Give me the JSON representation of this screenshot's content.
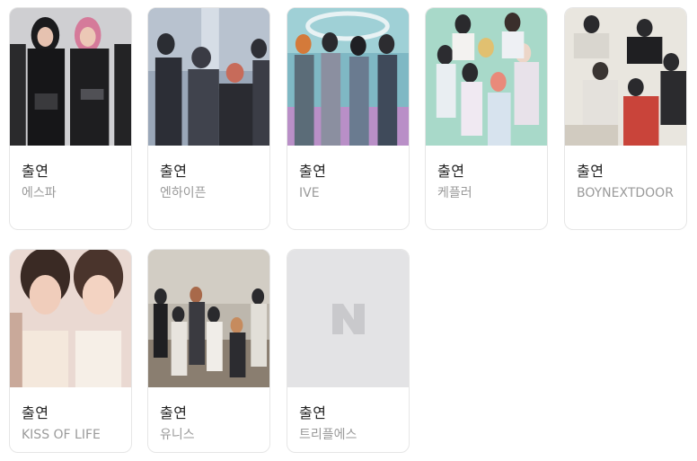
{
  "cards": [
    {
      "role": "출연",
      "name": "에스파"
    },
    {
      "role": "출연",
      "name": "엔하이픈"
    },
    {
      "role": "출연",
      "name": "IVE"
    },
    {
      "role": "출연",
      "name": "케플러"
    },
    {
      "role": "출연",
      "name": "BOYNEXTDOOR"
    },
    {
      "role": "출연",
      "name": "KISS OF LIFE"
    },
    {
      "role": "출연",
      "name": "유니스"
    },
    {
      "role": "출연",
      "name": "트리플에스"
    }
  ]
}
